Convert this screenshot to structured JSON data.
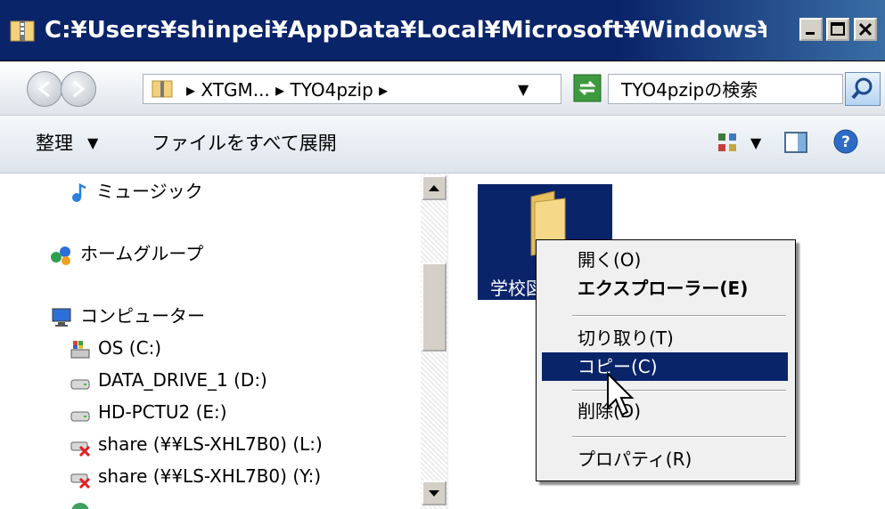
{
  "window": {
    "title": "C:¥Users¥shinpei¥AppData¥Local¥Microsoft¥Windows¥Temporary ..."
  },
  "address": {
    "path": "▸ XTGM... ▸ TYO4pzip ▸",
    "dropdown_glyph": "▼"
  },
  "search": {
    "placeholder": "TYO4pzipの検索"
  },
  "commandbar": {
    "organize": "整理",
    "extract_all": "ファイルをすべて展開",
    "caret": "▼"
  },
  "navpane": {
    "items": [
      {
        "label": "ミュージック",
        "icon": "music-icon"
      },
      {
        "label": "ホームグループ",
        "icon": "homegroup-icon"
      },
      {
        "label": "コンピューター",
        "icon": "computer-icon"
      },
      {
        "label": "OS (C:)",
        "icon": "os-drive-icon"
      },
      {
        "label": "DATA_DRIVE_1 (D:)",
        "icon": "drive-icon"
      },
      {
        "label": "HD-PCTU2 (E:)",
        "icon": "drive-icon"
      },
      {
        "label": "share (¥¥LS-XHL7B0) (L:)",
        "icon": "network-drive-disconnected-icon"
      },
      {
        "label": "share (¥¥LS-XHL7B0) (Y:)",
        "icon": "network-drive-disconnected-icon"
      }
    ]
  },
  "content": {
    "folder_label": "学校図"
  },
  "context_menu": {
    "items": [
      {
        "label": "開く(O)"
      },
      {
        "label": "エクスプローラー(E)"
      },
      {
        "label": "切り取り(T)"
      },
      {
        "label": "コピー(C)"
      },
      {
        "label": "削除(D)"
      },
      {
        "label": "プロパティ(R)"
      }
    ]
  },
  "colors": {
    "selection": "#0a246a",
    "titlebar": "#0a246a",
    "menu_bg": "#f0f0f0",
    "folder": "#f2d27a"
  }
}
